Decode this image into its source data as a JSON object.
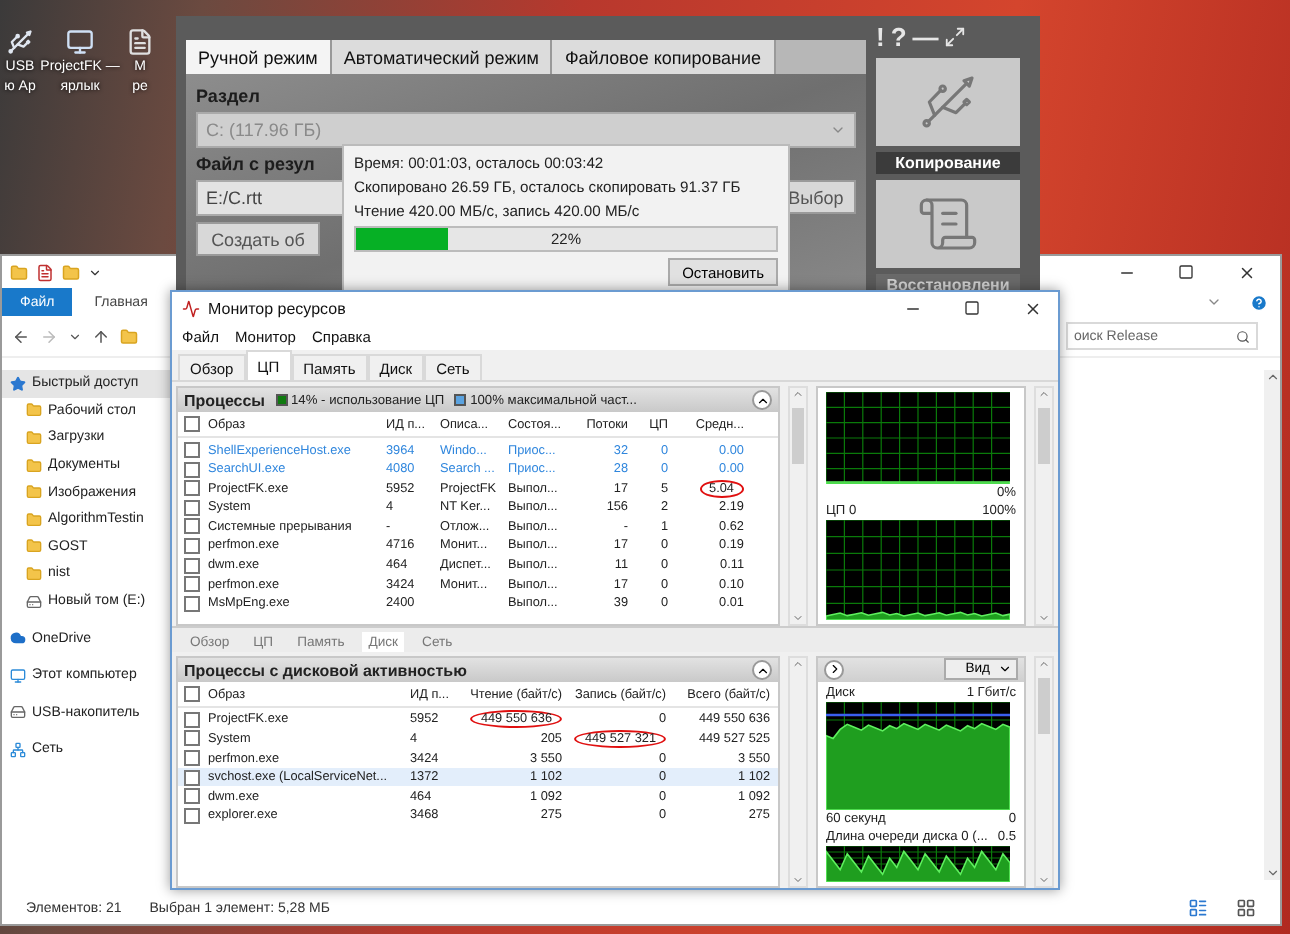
{
  "desktop": {
    "icons": [
      {
        "lines": [
          "USB",
          "ю Ар"
        ],
        "kind": "usb"
      },
      {
        "lines": [
          "ProjectFK —",
          "ярлык"
        ],
        "kind": "app"
      },
      {
        "lines": [
          "M",
          "ре"
        ],
        "kind": "doc"
      }
    ]
  },
  "explorer": {
    "ribbon_tabs": [
      {
        "label": "Файл",
        "selected": true
      },
      {
        "label": "Главная",
        "selected": false
      }
    ],
    "search": {
      "value": "оиск Release"
    },
    "sidebar": [
      {
        "label": "Быстрый доступ",
        "kind": "quick",
        "selected": true,
        "children": [
          {
            "label": "Рабочий стол",
            "kind": "folder",
            "selected": false
          },
          {
            "label": "Загрузки",
            "kind": "folder",
            "selected": false
          },
          {
            "label": "Документы",
            "kind": "folder",
            "selected": false
          },
          {
            "label": "Изображения",
            "kind": "folder",
            "selected": false
          },
          {
            "label": "AlgorithmTestin",
            "kind": "folder",
            "selected": false
          },
          {
            "label": "GOST",
            "kind": "folder",
            "selected": false
          },
          {
            "label": "nist",
            "kind": "folder",
            "selected": false
          },
          {
            "label": "Новый том (E:)",
            "kind": "drive",
            "selected": false
          }
        ]
      },
      {
        "label": "OneDrive",
        "kind": "cloud",
        "selected": false
      },
      {
        "label": "Этот компьютер",
        "kind": "pc",
        "selected": false
      },
      {
        "label": "USB-накопитель",
        "kind": "drive",
        "selected": false
      },
      {
        "label": "Сеть",
        "kind": "network",
        "selected": false
      }
    ],
    "status": [
      "Элементов: 21",
      "Выбран 1 элемент: 5,28 МБ"
    ]
  },
  "projectfk": {
    "tabs": [
      {
        "label": "Ручной режим",
        "selected": true
      },
      {
        "label": "Автоматический режим",
        "selected": false
      },
      {
        "label": "Файловое копирование",
        "selected": false
      }
    ],
    "partition_label": "Раздел",
    "partition": "C: (117.96 ГБ)",
    "file_label": "Файл с резул",
    "file_value": "E:/C.rtt",
    "browse_button": "Выбор",
    "create_button": "Создать об",
    "window_controls": [
      "!",
      "?",
      "—"
    ],
    "side_tiles": [
      {
        "label": "Копирование",
        "selected": true,
        "kind": "usb"
      },
      {
        "label": "Восстановлени",
        "selected": false,
        "kind": "scroll"
      }
    ],
    "progress": {
      "lines": [
        "Время: 00:01:03, осталось 00:03:42",
        "Скопировано 26.59 ГБ, осталось скопировать 91.37 ГБ",
        "Чтение 420.00 МБ/с, запись 420.00 МБ/с"
      ],
      "level": 0.22,
      "reading": "22%",
      "stop_button": "Остановить"
    }
  },
  "resmon": {
    "title": "Монитор ресурсов",
    "menu": [
      "Файл",
      "Монитор",
      "Справка"
    ],
    "tabs": [
      {
        "label": "Обзор",
        "selected": false
      },
      {
        "label": "ЦП",
        "selected": true
      },
      {
        "label": "Память",
        "selected": false
      },
      {
        "label": "Диск",
        "selected": false
      },
      {
        "label": "Сеть",
        "selected": false
      }
    ],
    "cpu": {
      "title": "Процессы",
      "all_checked": false,
      "badges": [
        {
          "text": "14% - использование ЦП",
          "color": "#0f7a0f"
        },
        {
          "text": "100% максимальной част...",
          "color": "#5ba3e0"
        }
      ],
      "columns": [
        "Образ",
        "ИД п...",
        "Описа...",
        "Состоя...",
        "Потоки",
        "ЦП",
        "Средн..."
      ],
      "rows": [
        {
          "image": "ShellExperienceHost.exe",
          "pid": "3964",
          "description": "Windo...",
          "status": "Приос...",
          "threads": "32",
          "cpu": "0",
          "avg": "0.00",
          "suspended": true,
          "checked": false
        },
        {
          "image": "SearchUI.exe",
          "pid": "4080",
          "description": "Search ...",
          "status": "Приос...",
          "threads": "28",
          "cpu": "0",
          "avg": "0.00",
          "suspended": true,
          "checked": false
        },
        {
          "image": "ProjectFK.exe",
          "pid": "5952",
          "description": "ProjectFK",
          "status": "Выпол...",
          "threads": "17",
          "cpu": "5",
          "avg": {
            "text": "5.04",
            "circled": true
          },
          "suspended": false,
          "checked": false
        },
        {
          "image": "System",
          "pid": "4",
          "description": "NT Ker...",
          "status": "Выпол...",
          "threads": "156",
          "cpu": "2",
          "avg": "2.19",
          "suspended": false,
          "checked": false
        },
        {
          "image": "Системные прерывания",
          "pid": "-",
          "description": "Отлож...",
          "status": "Выпол...",
          "threads": "-",
          "cpu": "1",
          "avg": "0.62",
          "suspended": false,
          "checked": false
        },
        {
          "image": "perfmon.exe",
          "pid": "4716",
          "description": "Монит...",
          "status": "Выпол...",
          "threads": "17",
          "cpu": "0",
          "avg": "0.19",
          "suspended": false,
          "checked": false
        },
        {
          "image": "dwm.exe",
          "pid": "464",
          "description": "Диспет...",
          "status": "Выпол...",
          "threads": "11",
          "cpu": "0",
          "avg": "0.11",
          "suspended": false,
          "checked": false
        },
        {
          "image": "perfmon.exe",
          "pid": "3424",
          "description": "Монит...",
          "status": "Выпол...",
          "threads": "17",
          "cpu": "0",
          "avg": "0.10",
          "suspended": false,
          "checked": false
        },
        {
          "image": "MsMpEng.exe",
          "pid": "2400",
          "status": "Выпол...",
          "threads": "39",
          "cpu": "0",
          "avg": "0.01",
          "suspended": false,
          "checked": false
        }
      ]
    },
    "cpu_graph_labels": [
      "0%",
      "ЦП 0",
      "100%"
    ],
    "disk_tabs": [
      {
        "label": "Обзор",
        "selected": false
      },
      {
        "label": "ЦП",
        "selected": false
      },
      {
        "label": "Память",
        "selected": false
      },
      {
        "label": "Диск",
        "selected": true
      },
      {
        "label": "Сеть",
        "selected": false
      }
    ],
    "disk": {
      "title": "Процессы с дисковой активностью",
      "all_checked": false,
      "columns": [
        "Образ",
        "ИД п...",
        "Чтение (байт/с)",
        "Запись (байт/с)",
        "Всего (байт/с)"
      ],
      "rows": [
        {
          "image": "ProjectFK.exe",
          "pid": "5952",
          "read": {
            "text": "449 550 636",
            "circled": true
          },
          "write": "0",
          "total": "449 550 636",
          "selected": false,
          "checked": false
        },
        {
          "image": "System",
          "pid": "4",
          "read": "205",
          "write": {
            "text": "449 527 321",
            "circled": true
          },
          "total": "449 527 525",
          "selected": false,
          "checked": false
        },
        {
          "image": "perfmon.exe",
          "pid": "3424",
          "read": "3 550",
          "write": "0",
          "total": "3 550",
          "selected": false,
          "checked": false
        },
        {
          "image": "svchost.exe (LocalServiceNet...",
          "pid": "1372",
          "read": "1 102",
          "write": "0",
          "total": "1 102",
          "selected": true,
          "checked": false
        },
        {
          "image": "dwm.exe",
          "pid": "464",
          "read": "1 092",
          "write": "0",
          "total": "1 092",
          "selected": false,
          "checked": false
        },
        {
          "image": "explorer.exe",
          "pid": "3468",
          "read": "275",
          "write": "0",
          "total": "275",
          "selected": false,
          "checked": false
        }
      ]
    },
    "view_button": "Вид",
    "disk_graph_labels": [
      "Диск",
      "1 Гбит/с",
      "60 секунд",
      "0",
      "Длина очереди диска 0 (...",
      "0.5"
    ]
  }
}
